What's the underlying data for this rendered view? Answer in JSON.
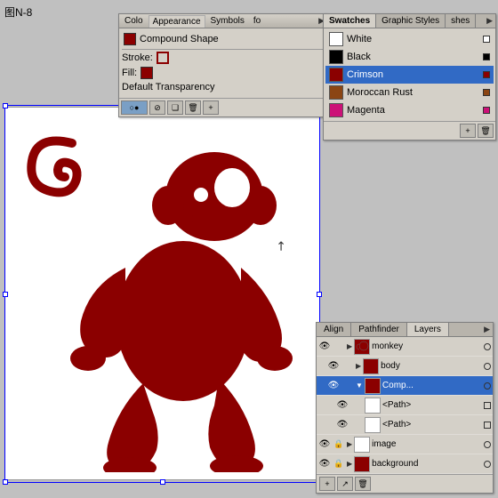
{
  "figure_label": "图N-8",
  "canvas": {
    "background": "white"
  },
  "appearance_panel": {
    "tabs": [
      "Colo",
      "Appearance",
      "Symbols",
      "fo"
    ],
    "active_tab": "Appearance",
    "compound_shape_label": "Compound Shape",
    "stroke_label": "Stroke:",
    "fill_label": "Fill:",
    "transparency_label": "Default Transparency"
  },
  "swatches_panel": {
    "tabs": [
      "Swatches",
      "Graphic Styles",
      "shes"
    ],
    "active_tab": "Swatches",
    "swatches": [
      {
        "name": "White",
        "color": "#ffffff"
      },
      {
        "name": "Black",
        "color": "#000000"
      },
      {
        "name": "Crimson",
        "color": "#8B0000",
        "selected": true
      },
      {
        "name": "Moroccan Rust",
        "color": "#8B4513"
      },
      {
        "name": "Magenta",
        "color": "#cc1177"
      }
    ]
  },
  "bottom_panel": {
    "tabs": [
      "Align",
      "Pathfinder",
      "Layers"
    ],
    "active_tab": "Layers",
    "layers": [
      {
        "name": "monkey",
        "level": 0,
        "expanded": true,
        "has_thumb": true,
        "thumb_color": "#8B0000"
      },
      {
        "name": "body",
        "level": 1,
        "expanded": false,
        "has_thumb": true,
        "thumb_color": "#8B0000"
      },
      {
        "name": "Comp...",
        "level": 1,
        "expanded": true,
        "selected": true,
        "has_thumb": true,
        "thumb_color": "#8B0000"
      },
      {
        "name": "<Path>",
        "level": 2,
        "expanded": false,
        "has_thumb": false
      },
      {
        "name": "<Path>",
        "level": 2,
        "expanded": false,
        "has_thumb": false
      },
      {
        "name": "image",
        "level": 0,
        "expanded": false,
        "has_thumb": false
      },
      {
        "name": "background",
        "level": 0,
        "expanded": false,
        "has_thumb": true,
        "thumb_color": "#8B0000"
      }
    ]
  },
  "cursor": "▶"
}
